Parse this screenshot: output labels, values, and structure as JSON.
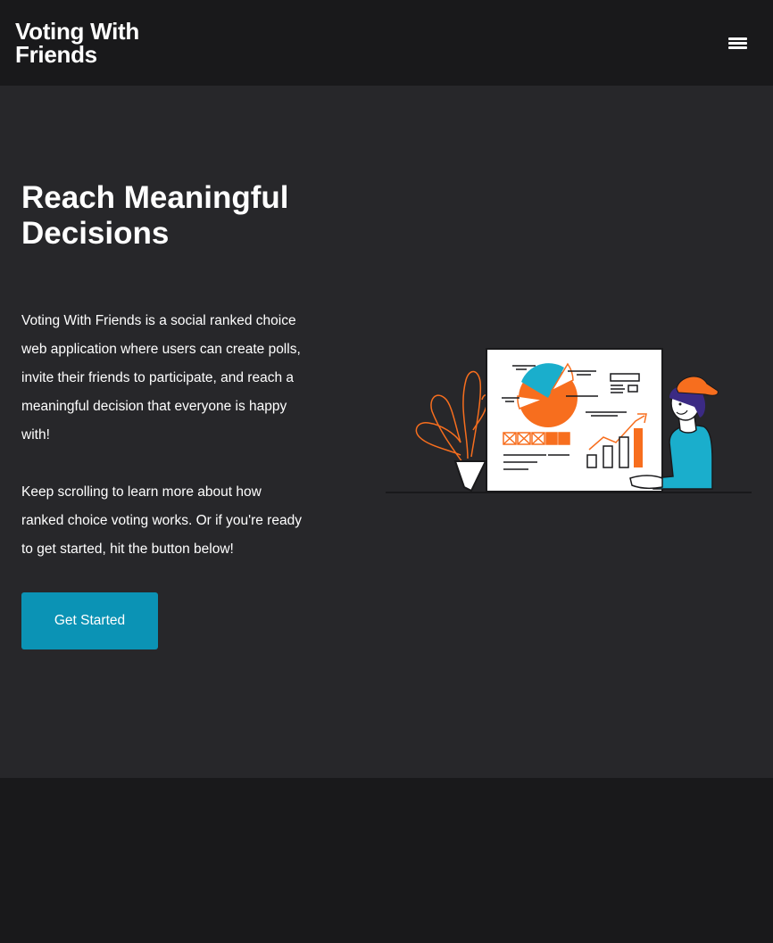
{
  "navbar": {
    "brand": "Voting With Friends",
    "menu_icon": "hamburger-menu-icon"
  },
  "hero": {
    "title": "Reach Meaningful Decisions",
    "paragraph_1": "Voting With Friends is a social ranked choice web application where users can create polls, invite their friends to participate, and reach a meaningful decision that everyone is happy with!",
    "paragraph_2": "Keep scrolling to learn more about how ranked choice voting works. Or if you're ready to get started, hit the button below!",
    "cta_label": "Get Started",
    "illustration": "presentation-board-illustration"
  },
  "colors": {
    "navbar_bg": "#19191b",
    "hero_bg": "#27272a",
    "accent": "#0b93b5",
    "orange": "#f76e1e",
    "cyan": "#1aaecc"
  }
}
